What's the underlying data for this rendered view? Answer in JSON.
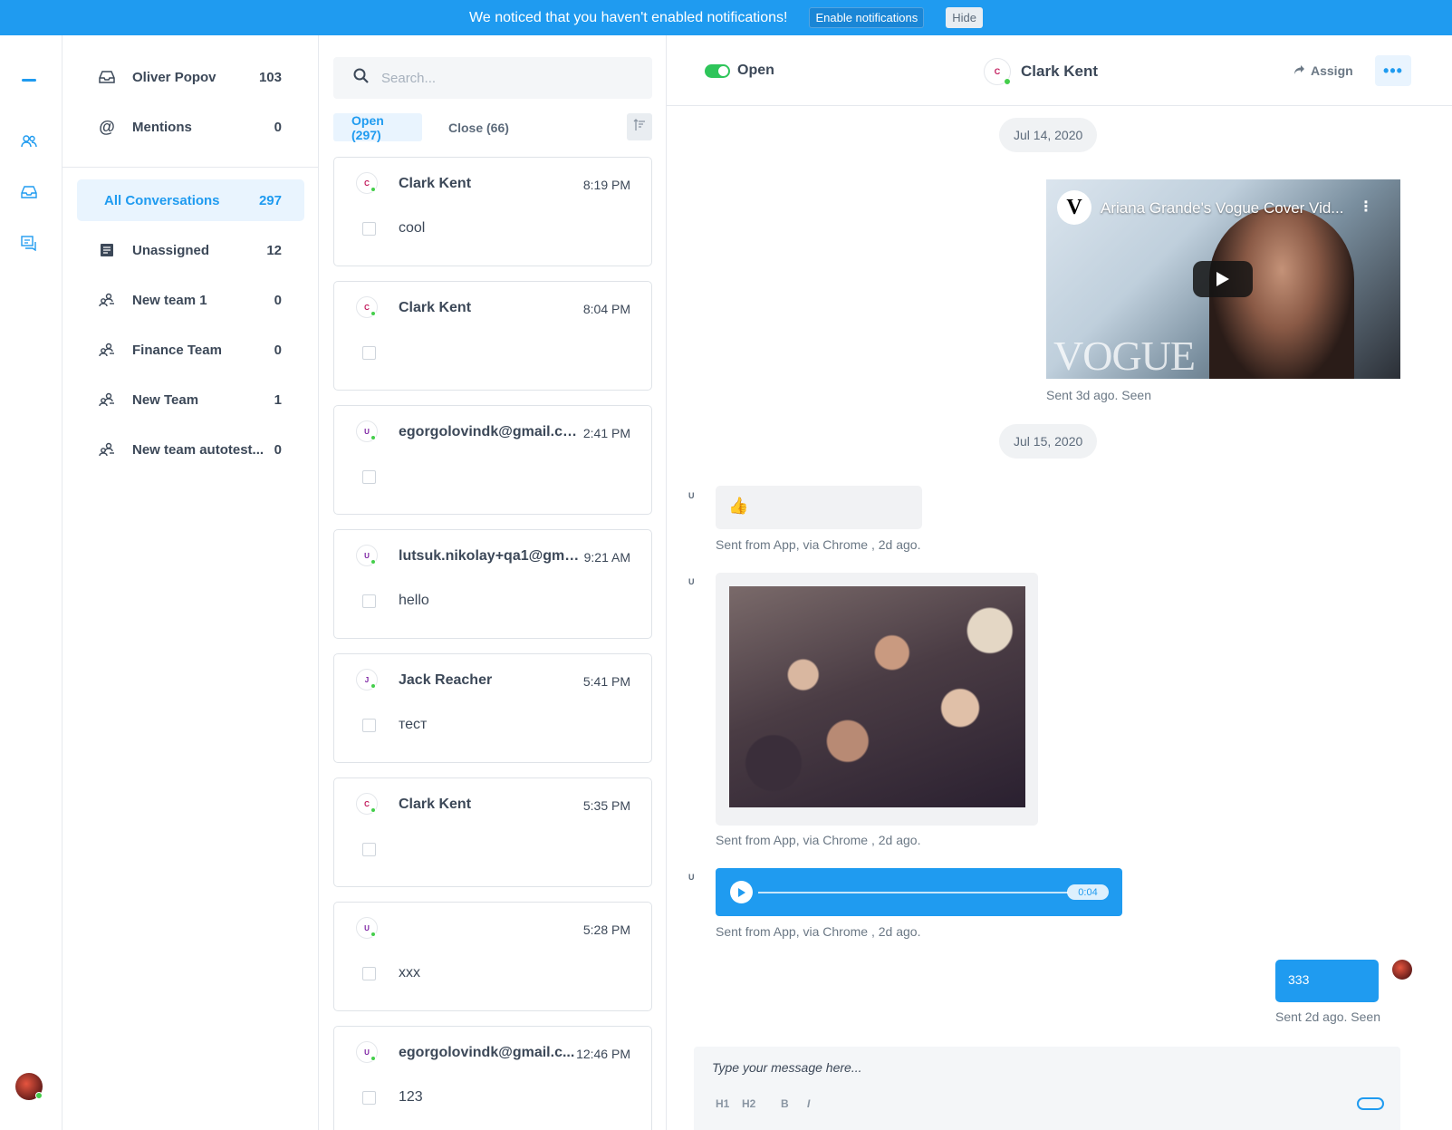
{
  "banner": {
    "message": "We noticed that you haven't enabled notifications!",
    "enable_label": "Enable notifications",
    "hide_label": "Hide"
  },
  "sidebar": {
    "personal": [
      {
        "label": "Oliver Popov",
        "count": "103",
        "icon": "inbox-icon"
      },
      {
        "label": "Mentions",
        "count": "0",
        "icon": "at-icon"
      }
    ],
    "inboxes": [
      {
        "label": "All Conversations",
        "count": "297",
        "icon": "",
        "active": true
      },
      {
        "label": "Unassigned",
        "count": "12",
        "icon": "document-icon"
      },
      {
        "label": "New team 1",
        "count": "0",
        "icon": "team-icon"
      },
      {
        "label": "Finance Team",
        "count": "0",
        "icon": "team-icon"
      },
      {
        "label": "New Team",
        "count": "1",
        "icon": "team-icon"
      },
      {
        "label": "New team autotest...",
        "count": "0",
        "icon": "team-icon"
      }
    ]
  },
  "list": {
    "search_placeholder": "Search...",
    "tabs": [
      {
        "label": "Open (297)",
        "active": true
      },
      {
        "label": "Close (66)",
        "active": false
      }
    ],
    "conversations": [
      {
        "initial": "C",
        "initial_color": "#c2185b",
        "name": "Clark Kent",
        "time": "8:19 PM",
        "message": "cool"
      },
      {
        "initial": "C",
        "initial_color": "#c2185b",
        "name": "Clark Kent",
        "time": "8:04 PM",
        "message": ""
      },
      {
        "initial": "U",
        "initial_color": "#7b1fa2",
        "name": "egorgolovindk@gmail.co...",
        "time": "2:41 PM",
        "message": ""
      },
      {
        "initial": "U",
        "initial_color": "#7b1fa2",
        "name": "lutsuk.nikolay+qa1@gma...",
        "time": "9:21 AM",
        "message": "hello"
      },
      {
        "initial": "J",
        "initial_color": "#7b1fa2",
        "name": "Jack Reacher",
        "time": "5:41 PM",
        "message": "тест"
      },
      {
        "initial": "C",
        "initial_color": "#c2185b",
        "name": "Clark Kent",
        "time": "5:35 PM",
        "message": ""
      },
      {
        "initial": "U",
        "initial_color": "#7b1fa2",
        "name": "",
        "time": "5:28 PM",
        "message": "xxx"
      },
      {
        "initial": "U",
        "initial_color": "#7b1fa2",
        "name": "egorgolovindk@gmail.c...",
        "time": "12:46 PM",
        "message": "123"
      }
    ]
  },
  "conversation": {
    "status": "Open",
    "contact_initial": "C",
    "contact_name": "Clark Kent",
    "assign_label": "Assign",
    "more_label": "•••",
    "dates": [
      "Jul 14, 2020",
      "Jul 15, 2020"
    ],
    "video": {
      "logo_letter": "V",
      "title": "Ariana Grande's Vogue Cover Vid...",
      "brand": "VOGUE",
      "meta": "Sent 3d ago. Seen"
    },
    "sender_initial": "U",
    "emoji": "👍",
    "emoji_meta": "Sent from App, via Chrome , 2d ago.",
    "image_meta": "Sent from App, via Chrome , 2d ago.",
    "audio": {
      "time": "0:04",
      "progress": 0
    },
    "audio_meta": "Sent from App, via Chrome , 2d ago.",
    "outgoing": {
      "text": "333",
      "meta": "Sent 2d ago. Seen"
    }
  },
  "composer": {
    "placeholder": "Type your message here...",
    "tools": [
      "H1",
      "H2",
      "B",
      "I",
      "list-icon",
      "ordered-list-icon",
      "bullet-list-icon",
      "attach-icon",
      "image-icon",
      "emoji-icon",
      "mic-icon"
    ]
  },
  "colors": {
    "accent": "#1f9bf0",
    "online": "#44ce4b",
    "toggle_on": "#2ec55a"
  }
}
